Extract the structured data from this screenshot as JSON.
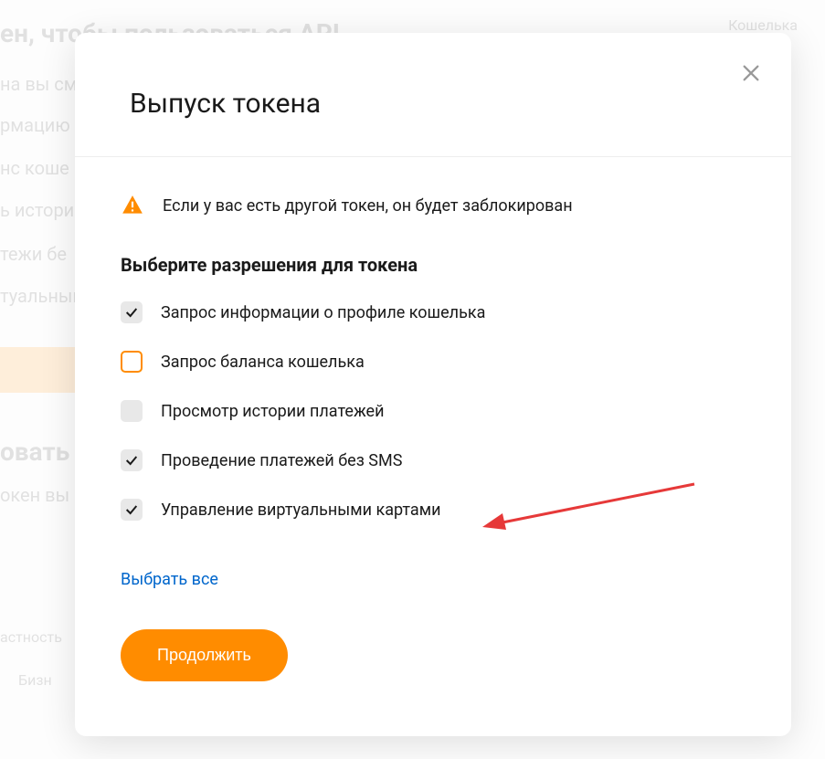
{
  "background": {
    "heading": "ен, чтобы пользоваться API",
    "line1": "на вы см",
    "line2": "рмацию",
    "line3": "нс коше",
    "line4": "ь истори",
    "line5": "тежи бе",
    "line6": "туальным",
    "line7": "овать т",
    "line8": "окен вы м",
    "line9": "астность",
    "line10": "Бизн",
    "topright": "Кошелька"
  },
  "modal": {
    "title": "Выпуск токена",
    "warning": "Если у вас есть другой токен, он будет заблокирован",
    "section_title": "Выберите разрешения для токена",
    "permissions": [
      {
        "label": "Запрос информации о профиле кошелька",
        "state": "checked-grey"
      },
      {
        "label": "Запрос баланса кошелька",
        "state": "unchecked-orange"
      },
      {
        "label": "Просмотр истории платежей",
        "state": "unchecked-grey"
      },
      {
        "label": "Проведение платежей без SMS",
        "state": "checked-grey"
      },
      {
        "label": "Управление виртуальными картами",
        "state": "checked-grey"
      }
    ],
    "select_all": "Выбрать все",
    "continue": "Продолжить"
  }
}
